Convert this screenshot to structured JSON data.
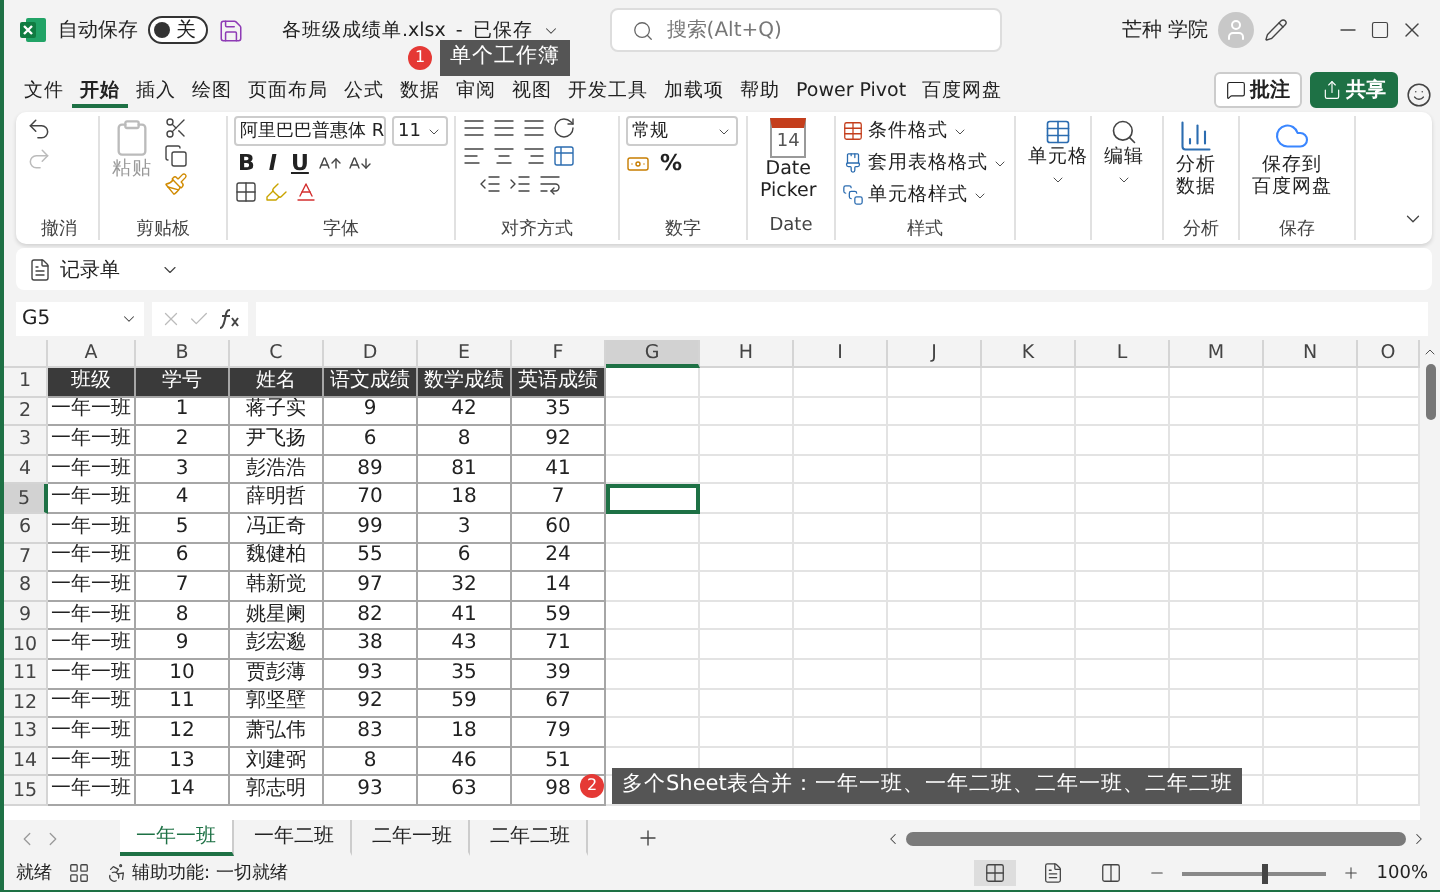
{
  "title_bar": {
    "autosave_label": "自动保存",
    "autosave_on": false,
    "autosave_state": "关",
    "file_name": "各班级成绩单.xlsx",
    "separator": "-",
    "save_status": "已保存",
    "search_placeholder": "搜索(Alt+Q)",
    "user": "芒种 学院"
  },
  "menu": [
    {
      "label": "文件",
      "selected": false
    },
    {
      "label": "开始",
      "selected": true
    },
    {
      "label": "插入",
      "selected": false
    },
    {
      "label": "绘图",
      "selected": false
    },
    {
      "label": "页面布局",
      "selected": false
    },
    {
      "label": "公式",
      "selected": false
    },
    {
      "label": "数据",
      "selected": false
    },
    {
      "label": "审阅",
      "selected": false
    },
    {
      "label": "视图",
      "selected": false
    },
    {
      "label": "开发工具",
      "selected": false
    },
    {
      "label": "加载项",
      "selected": false
    },
    {
      "label": "帮助",
      "selected": false
    },
    {
      "label": "Power Pivot",
      "selected": false
    },
    {
      "label": "百度网盘",
      "selected": false
    }
  ],
  "comment_button": "批注",
  "share_button": "共享",
  "ribbon": {
    "undo": {
      "label": "撤消"
    },
    "clipboard": {
      "label": "剪贴板",
      "paste": "粘贴"
    },
    "font": {
      "label": "字体",
      "name": "阿里巴巴普惠体 R",
      "size": "11",
      "bold": "B",
      "italic": "I",
      "underline": "U"
    },
    "alignment": {
      "label": "对齐方式"
    },
    "number": {
      "label": "数字",
      "format": "常规",
      "percent": "%"
    },
    "date": {
      "label": "Date",
      "day": "14",
      "button": [
        "Date",
        "Picker"
      ]
    },
    "styles": {
      "label": "样式",
      "items": [
        "条件格式",
        "套用表格格式",
        "单元格样式"
      ]
    },
    "cells": {
      "button": "单元格"
    },
    "editing": {
      "button": "编辑"
    },
    "analysis": {
      "label": "分析",
      "button": [
        "分析",
        "数据"
      ]
    },
    "save": {
      "label": "保存",
      "button": [
        "保存到",
        "百度网盘"
      ]
    }
  },
  "quick_access": {
    "button": "记录单"
  },
  "formula_bar": {
    "name_box": "G5"
  },
  "columns": [
    {
      "letter": "A",
      "selected": false
    },
    {
      "letter": "B",
      "selected": false
    },
    {
      "letter": "C",
      "selected": false
    },
    {
      "letter": "D",
      "selected": false
    },
    {
      "letter": "E",
      "selected": false
    },
    {
      "letter": "F",
      "selected": false
    },
    {
      "letter": "G",
      "selected": true
    },
    {
      "letter": "H",
      "selected": false
    },
    {
      "letter": "I",
      "selected": false
    },
    {
      "letter": "J",
      "selected": false
    },
    {
      "letter": "K",
      "selected": false
    },
    {
      "letter": "L",
      "selected": false
    },
    {
      "letter": "M",
      "selected": false
    },
    {
      "letter": "N",
      "selected": false
    },
    {
      "letter": "O",
      "selected": false
    }
  ],
  "rows": [
    {
      "number": "1",
      "selected": false,
      "kind": "header",
      "cells": [
        "班级",
        "学号",
        "姓名",
        "语文成绩",
        "数学成绩",
        "英语成绩"
      ]
    },
    {
      "number": "2",
      "selected": false,
      "kind": "data",
      "cells": [
        "一年一班",
        "1",
        "蒋子实",
        "9",
        "42",
        "35"
      ]
    },
    {
      "number": "3",
      "selected": false,
      "kind": "data",
      "cells": [
        "一年一班",
        "2",
        "尹飞扬",
        "6",
        "8",
        "92"
      ]
    },
    {
      "number": "4",
      "selected": false,
      "kind": "data",
      "cells": [
        "一年一班",
        "3",
        "彭浩浩",
        "89",
        "81",
        "41"
      ]
    },
    {
      "number": "5",
      "selected": true,
      "kind": "data",
      "cells": [
        "一年一班",
        "4",
        "薛明哲",
        "70",
        "18",
        "7"
      ]
    },
    {
      "number": "6",
      "selected": false,
      "kind": "data",
      "cells": [
        "一年一班",
        "5",
        "冯正奇",
        "99",
        "3",
        "60"
      ]
    },
    {
      "number": "7",
      "selected": false,
      "kind": "data",
      "cells": [
        "一年一班",
        "6",
        "魏健柏",
        "55",
        "6",
        "24"
      ]
    },
    {
      "number": "8",
      "selected": false,
      "kind": "data",
      "cells": [
        "一年一班",
        "7",
        "韩新觉",
        "97",
        "32",
        "14"
      ]
    },
    {
      "number": "9",
      "selected": false,
      "kind": "data",
      "cells": [
        "一年一班",
        "8",
        "姚星阑",
        "82",
        "41",
        "59"
      ]
    },
    {
      "number": "10",
      "selected": false,
      "kind": "data",
      "cells": [
        "一年一班",
        "9",
        "彭宏邈",
        "38",
        "43",
        "71"
      ]
    },
    {
      "number": "11",
      "selected": false,
      "kind": "data",
      "cells": [
        "一年一班",
        "10",
        "贾彭薄",
        "93",
        "35",
        "39"
      ]
    },
    {
      "number": "12",
      "selected": false,
      "kind": "data",
      "cells": [
        "一年一班",
        "11",
        "郭坚壁",
        "92",
        "59",
        "67"
      ]
    },
    {
      "number": "13",
      "selected": false,
      "kind": "data",
      "cells": [
        "一年一班",
        "12",
        "萧弘伟",
        "83",
        "18",
        "79"
      ]
    },
    {
      "number": "14",
      "selected": false,
      "kind": "data",
      "cells": [
        "一年一班",
        "13",
        "刘建弼",
        "8",
        "46",
        "51"
      ]
    },
    {
      "number": "15",
      "selected": false,
      "kind": "data",
      "cells": [
        "一年一班",
        "14",
        "郭志明",
        "93",
        "63",
        "98"
      ]
    }
  ],
  "sheet_tabs": [
    {
      "label": "一年一班",
      "selected": true
    },
    {
      "label": "一年二班",
      "selected": false
    },
    {
      "label": "二年一班",
      "selected": false
    },
    {
      "label": "二年二班",
      "selected": false
    }
  ],
  "status_bar": {
    "ready": "就绪",
    "accessibility": "辅助功能: 一切就绪",
    "zoom": "100%",
    "zoom_level": {
      "level": 0.55
    }
  },
  "callouts": [
    {
      "number": "1",
      "text": "单个工作簿"
    },
    {
      "number": "2",
      "text": "多个Sheet表合并：一年一班、一年二班、二年一班、二年二班"
    }
  ]
}
